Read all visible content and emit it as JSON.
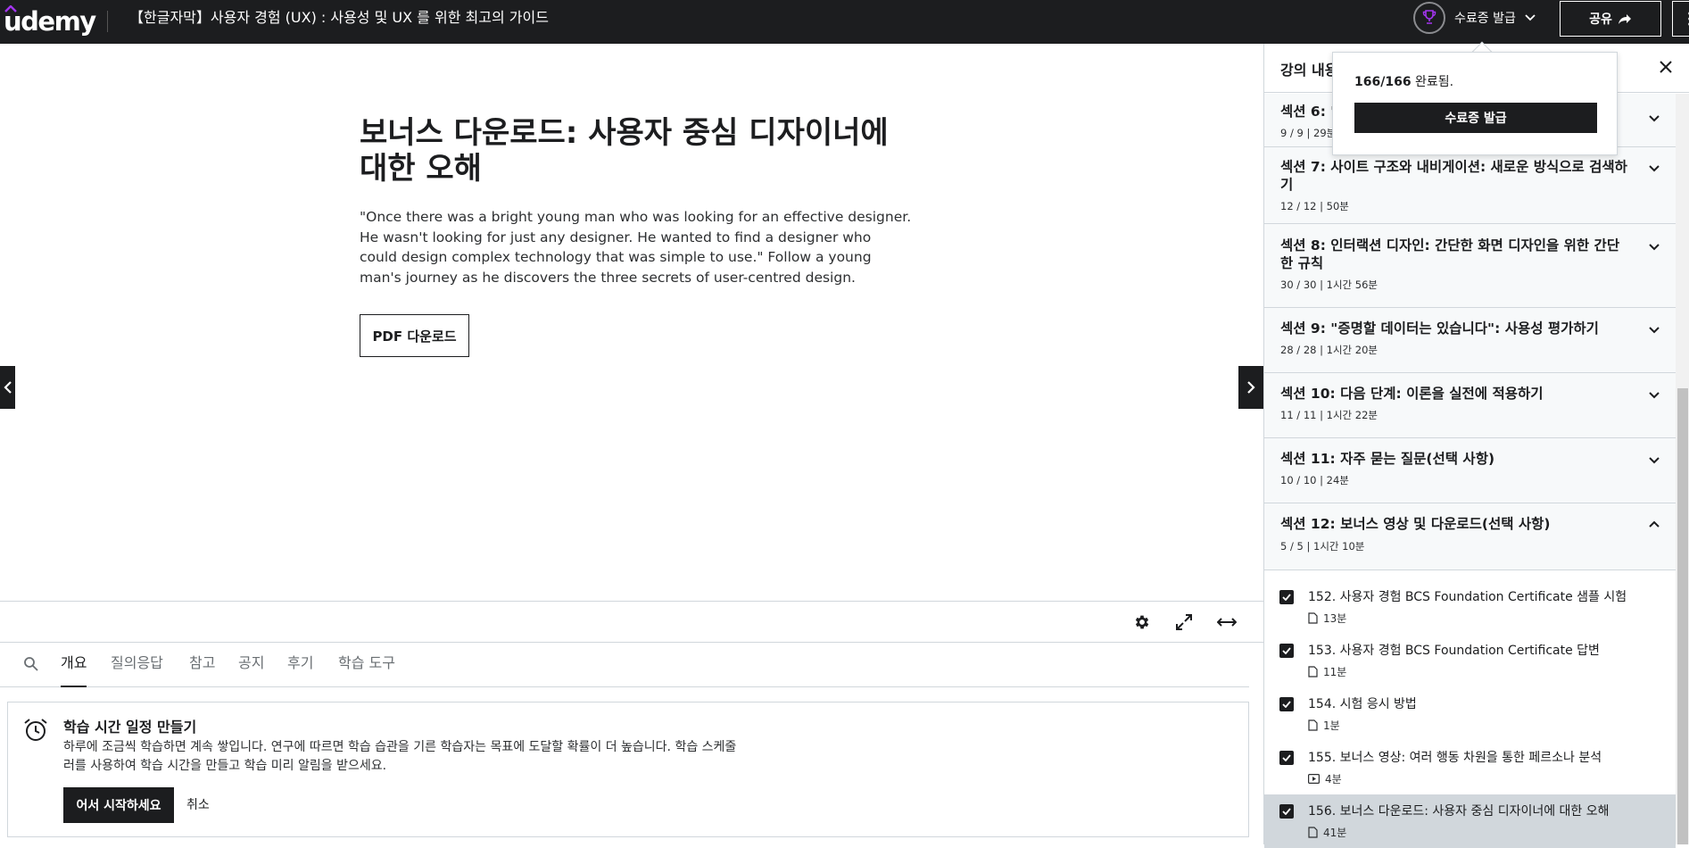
{
  "brand": {
    "logo_text": "Udemy",
    "accent": "#a435f0",
    "dark": "#1c1d1f"
  },
  "header": {
    "course_title": "【한글자막】사용자 경험 (UX) : 사용성 및 UX 를 위한 최고의 가이드",
    "certificate_label": "수료증 발급",
    "share_label": "공유"
  },
  "lecture": {
    "title": "보너스 다운로드: 사용자 중심 디자이너에 대한 오해",
    "description": "\"Once there was a bright young man who was looking for an effective designer. He wasn't looking for just any designer. He wanted to find a designer who could design complex technology that was simple to use.\" Follow a young man's journey as he discovers the three secrets of user-centred design.",
    "pdf_button": "PDF 다운로드"
  },
  "tabs": [
    {
      "label": "개요",
      "active": true
    },
    {
      "label": "질의응답",
      "active": false
    },
    {
      "label": "참고",
      "active": false
    },
    {
      "label": "공지",
      "active": false
    },
    {
      "label": "후기",
      "active": false
    },
    {
      "label": "학습 도구",
      "active": false
    }
  ],
  "schedule": {
    "title": "학습 시간 일정 만들기",
    "description": "하루에 조금씩 학습하면 계속 쌓입니다. 연구에 따르면 학습 습관을 기른 학습자는 목표에 도달할 확률이 더 높습니다. 학습 스케줄러를 사용하여 학습 시간을 만들고 학습 미리 알림을 받으세요.",
    "start_button": "어서 시작하세요",
    "cancel_button": "취소"
  },
  "sidebar": {
    "title": "강의 내용",
    "sections": [
      {
        "title": "섹션 6: \"",
        "meta": "9 / 9 | 29분",
        "expanded": false
      },
      {
        "title": "섹션 7: 사이트 구조와 내비게이션: 새로운 방식으로 검색하기",
        "meta": "12 / 12 | 50분",
        "expanded": false
      },
      {
        "title": "섹션 8: 인터랙션 디자인: 간단한 화면 디자인을 위한 간단한 규칙",
        "meta": "30 / 30 | 1시간 56분",
        "expanded": false
      },
      {
        "title": "섹션 9: \"증명할 데이터는 있습니다\": 사용성 평가하기",
        "meta": "28 / 28 | 1시간 20분",
        "expanded": false
      },
      {
        "title": "섹션 10: 다음 단계: 이론을 실전에 적용하기",
        "meta": "11 / 11 | 1시간 22분",
        "expanded": false
      },
      {
        "title": "섹션 11: 자주 묻는 질문(선택 사항)",
        "meta": "10 / 10 | 24분",
        "expanded": false
      },
      {
        "title": "섹션 12: 보너스 영상 및 다운로드(선택 사항)",
        "meta": "5 / 5 | 1시간 10분",
        "expanded": true
      }
    ],
    "items": [
      {
        "title": "152. 사용자 경험 BCS Foundation Certificate 샘플 시험",
        "duration": "13분",
        "type": "document",
        "checked": true,
        "current": false
      },
      {
        "title": "153. 사용자 경험 BCS Foundation Certificate 답변",
        "duration": "11분",
        "type": "document",
        "checked": true,
        "current": false
      },
      {
        "title": "154. 시험 응시 방법",
        "duration": "1분",
        "type": "document",
        "checked": true,
        "current": false
      },
      {
        "title": "155. 보너스 영상: 여러 행동 차원을 통한 페르소나 분석",
        "duration": "4분",
        "type": "video",
        "checked": true,
        "current": false
      },
      {
        "title": "156. 보너스 다운로드: 사용자 중심 디자이너에 대한 오해",
        "duration": "41분",
        "type": "document",
        "checked": true,
        "current": true
      }
    ]
  },
  "popup": {
    "progress_count": "166/166",
    "progress_suffix": " 완료됨.",
    "button": "수료증 발급"
  }
}
